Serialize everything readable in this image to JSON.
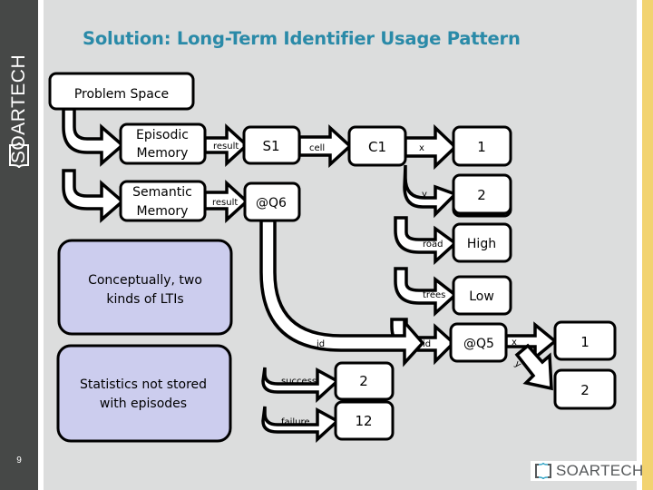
{
  "slide": {
    "title": "Solution: Long-Term Identifier Usage Pattern",
    "page_number": "9",
    "brand_vertical": "SOARTECH",
    "brand_footer": "SOARTECH",
    "colors": {
      "title": "#2a8aa8",
      "sidebar": "#464847",
      "accent_strip": "#f2d370",
      "background": "#dcdddd",
      "note_fill": "#cccdee"
    }
  },
  "diagram": {
    "nodes": {
      "problem_space": "Problem Space",
      "episodic_l1": "Episodic",
      "episodic_l2": "Memory",
      "semantic_l1": "Semantic",
      "semantic_l2": "Memory",
      "s1": "S1",
      "q6": "@Q6",
      "c1": "C1",
      "x_val": "1",
      "y_val": "2",
      "road_val": "High",
      "trees_val": "Low",
      "q5": "@Q5",
      "q5_x_val": "1",
      "q5_y_val": "2",
      "success_val": "2",
      "failure_val": "12"
    },
    "edges": {
      "epi_result": "result",
      "sem_result": "result",
      "cell": "cell",
      "x": "x",
      "y": "y",
      "road": "road",
      "trees": "trees",
      "id_q6": "id",
      "id_q5": "id",
      "q5_x": "x",
      "q5_y": "y",
      "success": "success",
      "failure": "failure"
    },
    "notes": {
      "ltis_l1": "Conceptually, two",
      "ltis_l2": "kinds of LTIs",
      "stats_l1": "Statistics not stored",
      "stats_l2": "with episodes"
    }
  }
}
